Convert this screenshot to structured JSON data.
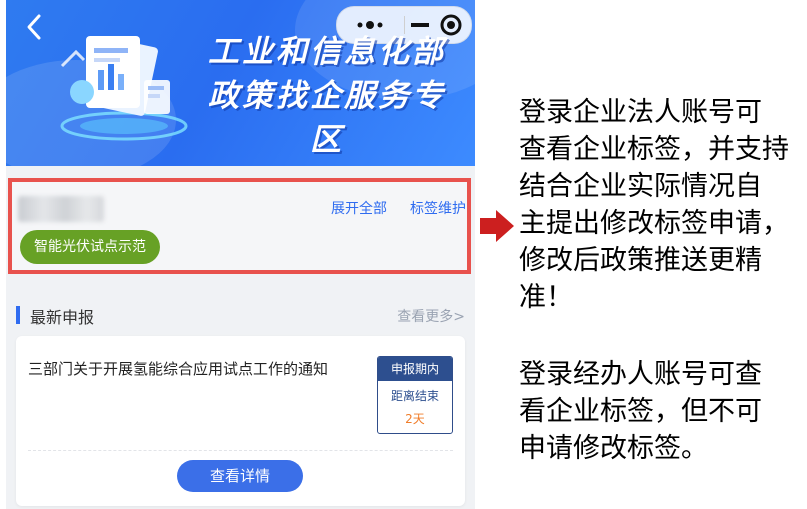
{
  "banner": {
    "title_line1": "工业和信息化部",
    "title_line2": "政策找企服务专区"
  },
  "tag_card": {
    "expand_all": "展开全部",
    "tag_maintenance": "标签维护",
    "tag": "智能光伏试点示范"
  },
  "latest": {
    "title": "最新申报",
    "see_more": "查看更多>",
    "item": {
      "title": "三部门关于开展氢能综合应用试点工作的通知",
      "period_label": "申报期内",
      "countdown_label": "距离结束",
      "days_left": "2天",
      "detail_button": "查看详情"
    }
  },
  "notes": {
    "note1": [
      "登录企业法人账号可",
      "查看企业标签，并支持",
      "结合企业实际情况自",
      "主提出修改标签申请，",
      "修改后政策推送更精",
      "准！"
    ],
    "note2": [
      "登录经办人账号可查",
      "看企业标签，但不可",
      "申请修改标签。"
    ]
  },
  "colors": {
    "brand_blue": "#2f6cf0",
    "highlight_red": "#e8524d",
    "tag_green": "#67a125",
    "arrow_red": "#cc1f1f"
  }
}
